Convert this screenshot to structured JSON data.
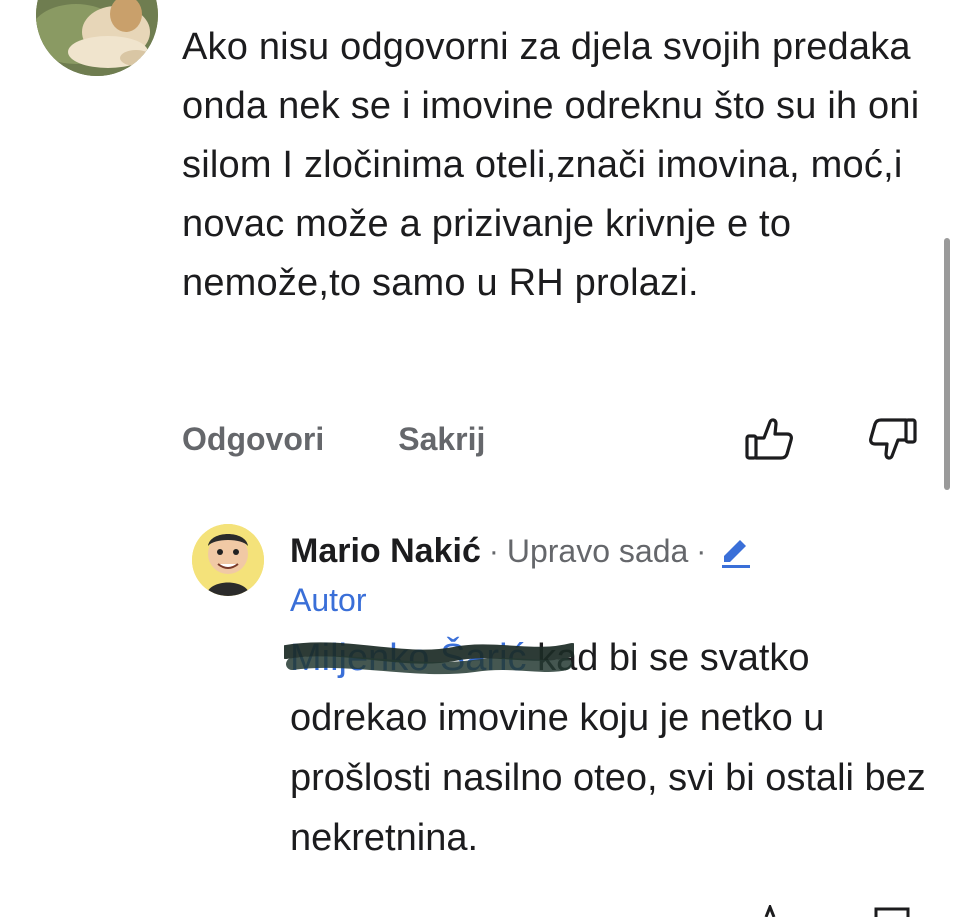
{
  "comments": [
    {
      "text": "Ako nisu odgovorni za djela svojih predaka onda nek se i imovine odreknu što su ih oni silom I zločinima oteli,znači  imovina, moć,i novac može a prizivanje krivnje e to nemože,to samo u RH prolazi.",
      "actions": {
        "reply_label": "Odgovori",
        "hide_label": "Sakrij"
      }
    }
  ],
  "reply": {
    "author": "Mario Nakić",
    "separator": "·",
    "time": "Upravo sada",
    "role": "Autor",
    "mention": "Miljenko Šarić",
    "text": " kad bi se svatko odrekao imovine koju je netko u prošlosti nasilno oteo, svi bi ostali bez nekretnina."
  },
  "icons": {
    "like": "thumbs-up-icon",
    "dislike": "thumbs-down-icon",
    "edit": "pencil-icon",
    "accent_color": "#3a6fd8",
    "muted_color": "#65676b"
  }
}
